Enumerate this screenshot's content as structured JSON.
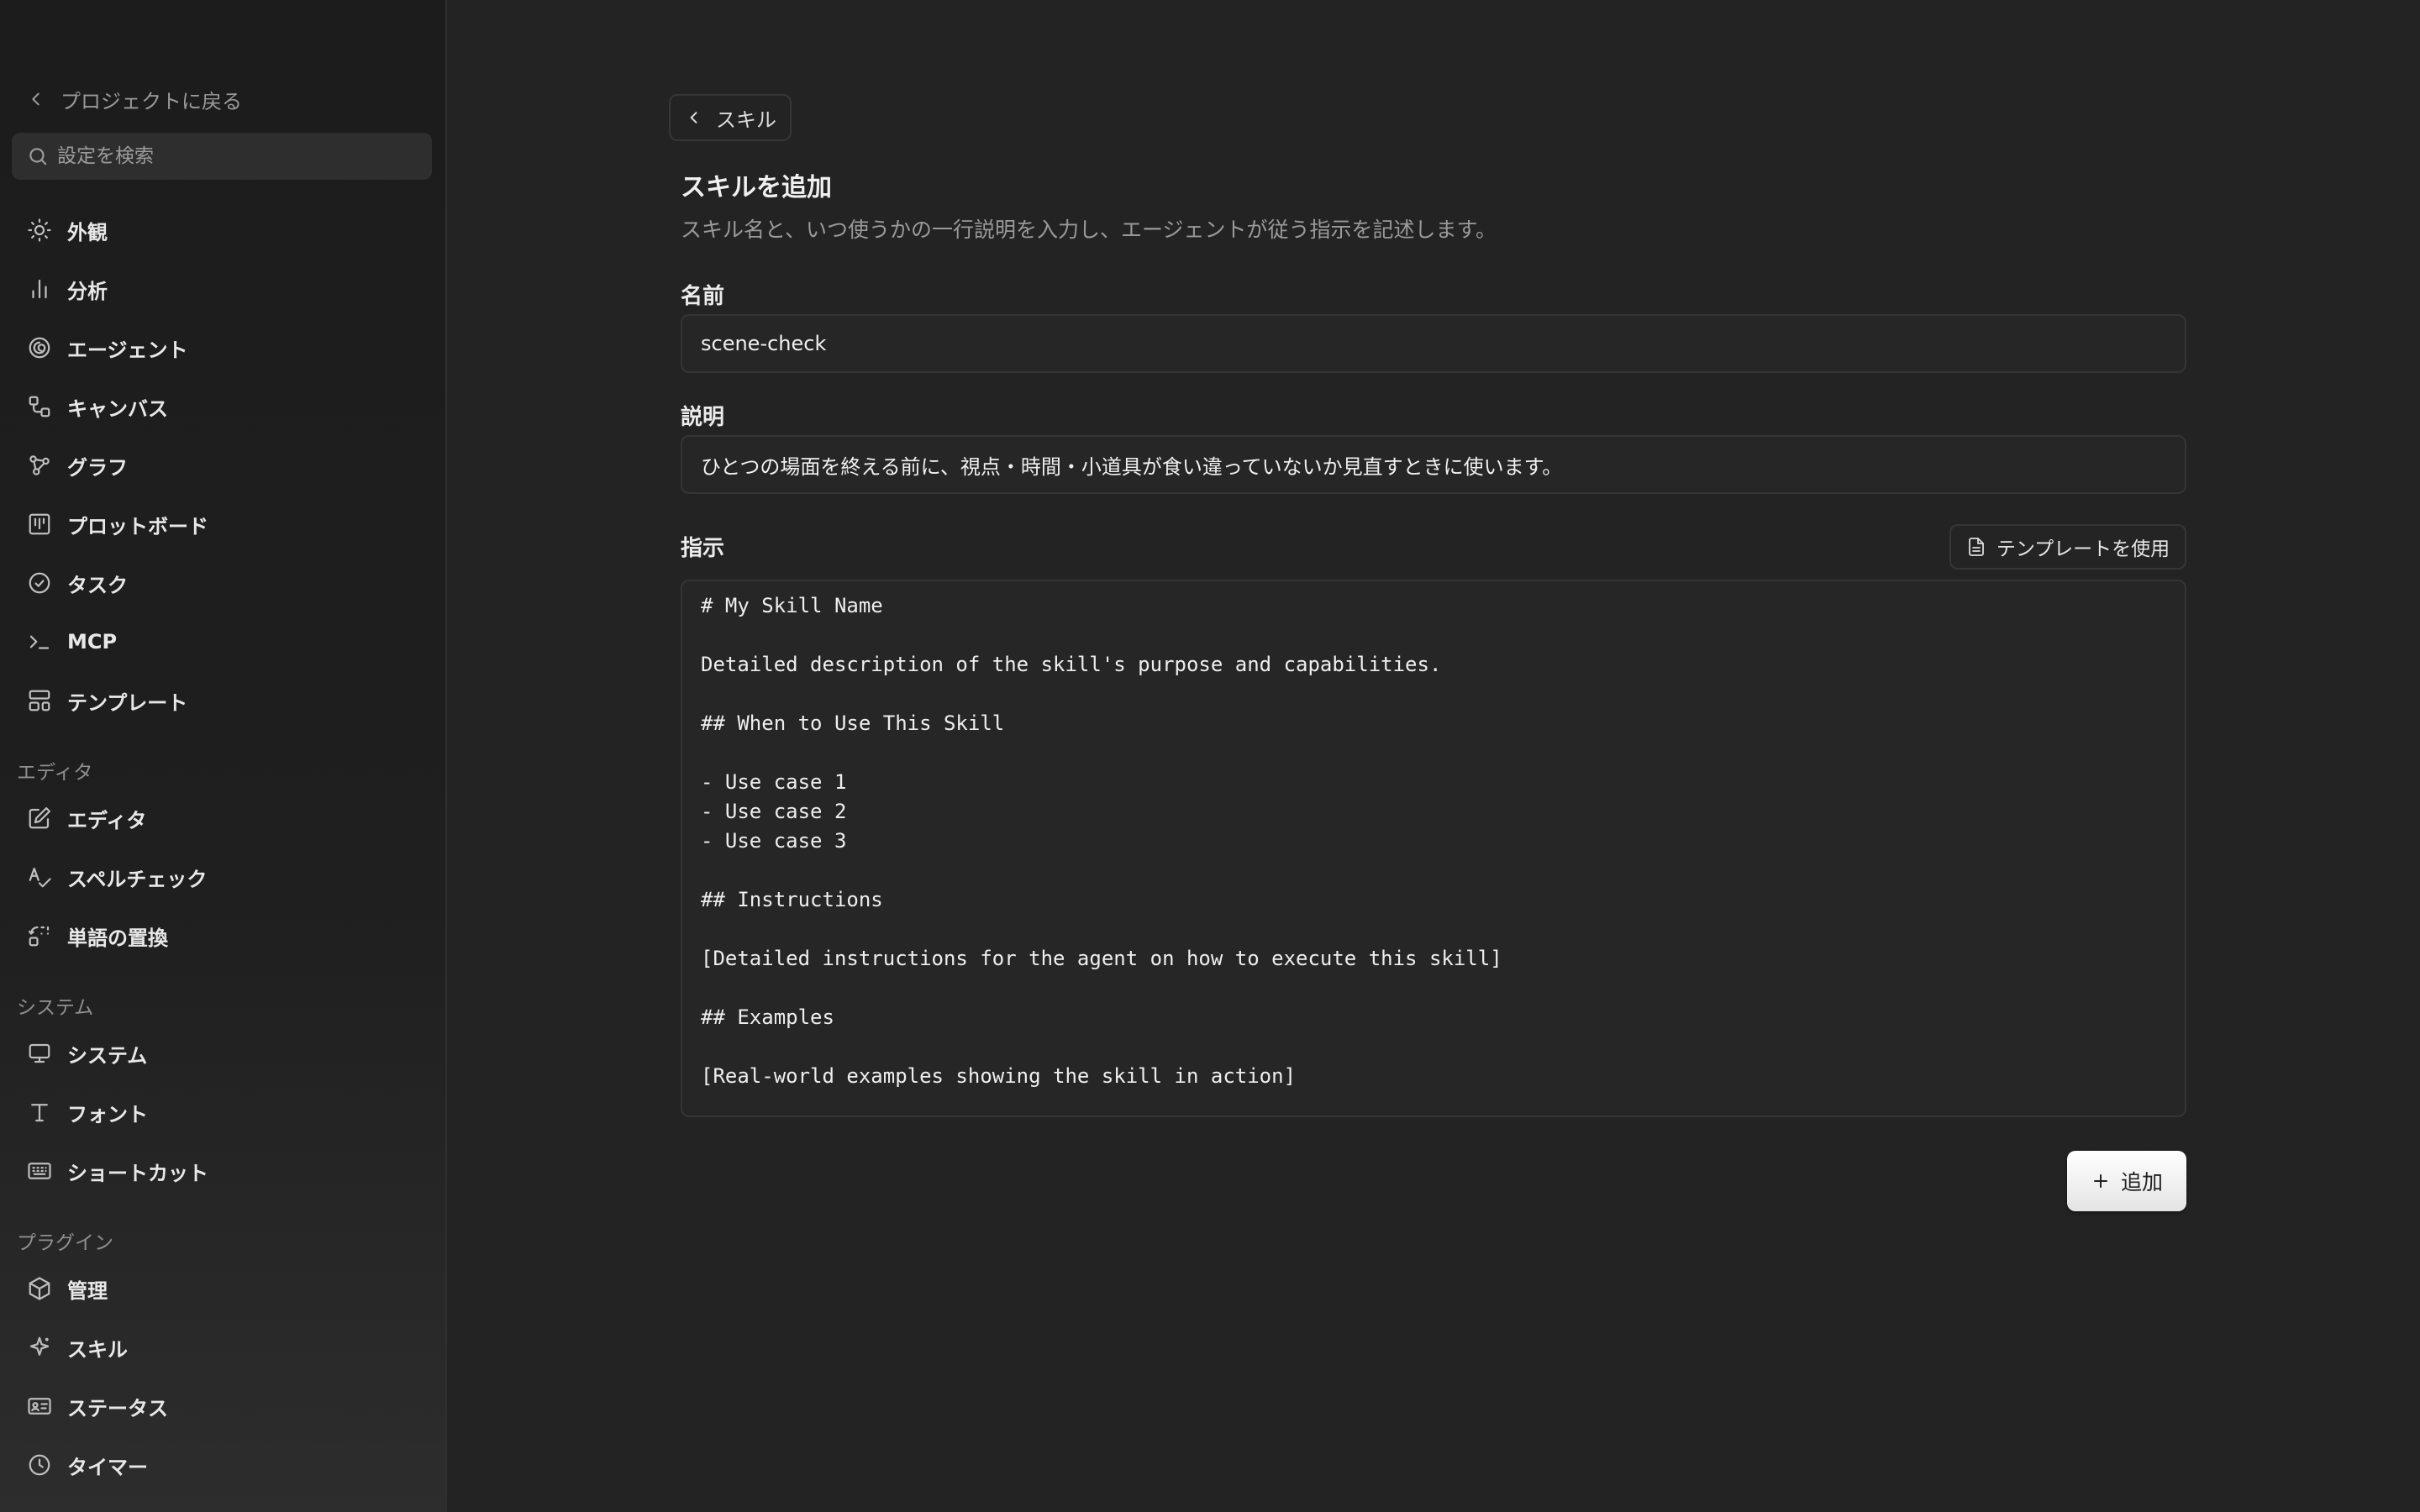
{
  "sidebar": {
    "back_label": "プロジェクトに戻る",
    "search_placeholder": "設定を検索",
    "items_general": [
      {
        "label": "外観",
        "icon": "sun-icon"
      },
      {
        "label": "分析",
        "icon": "bar-chart-icon"
      },
      {
        "label": "エージェント",
        "icon": "spiral-icon"
      },
      {
        "label": "キャンバス",
        "icon": "canvas-icon"
      },
      {
        "label": "グラフ",
        "icon": "graph-icon"
      },
      {
        "label": "プロットボード",
        "icon": "kanban-icon"
      },
      {
        "label": "タスク",
        "icon": "check-circle-icon"
      },
      {
        "label": "MCP",
        "icon": "terminal-icon"
      },
      {
        "label": "テンプレート",
        "icon": "layout-icon"
      }
    ],
    "section_editor": "エディタ",
    "items_editor": [
      {
        "label": "エディタ",
        "icon": "edit-icon"
      },
      {
        "label": "スペルチェック",
        "icon": "spellcheck-icon"
      },
      {
        "label": "単語の置換",
        "icon": "replace-icon"
      }
    ],
    "section_system": "システム",
    "items_system": [
      {
        "label": "システム",
        "icon": "monitor-icon"
      },
      {
        "label": "フォント",
        "icon": "type-icon"
      },
      {
        "label": "ショートカット",
        "icon": "keyboard-icon"
      }
    ],
    "section_plugins": "プラグイン",
    "items_plugins": [
      {
        "label": "管理",
        "icon": "package-icon"
      },
      {
        "label": "スキル",
        "icon": "sparkle-icon"
      },
      {
        "label": "ステータス",
        "icon": "id-card-icon"
      },
      {
        "label": "タイマー",
        "icon": "clock-icon"
      }
    ]
  },
  "main": {
    "breadcrumb_label": "スキル",
    "title": "スキルを追加",
    "description": "スキル名と、いつ使うかの一行説明を入力し、エージェントが従う指示を記述します。",
    "name_label": "名前",
    "name_value": "scene-check",
    "desc_label": "説明",
    "desc_value": "ひとつの場面を終える前に、視点・時間・小道具が食い違っていないか見直すときに使います。",
    "instructions_label": "指示",
    "template_button": "テンプレートを使用",
    "instructions_value": "# My Skill Name\n\nDetailed description of the skill's purpose and capabilities.\n\n## When to Use This Skill\n\n- Use case 1\n- Use case 2\n- Use case 3\n\n## Instructions\n\n[Detailed instructions for the agent on how to execute this skill]\n\n## Examples\n\n[Real-world examples showing the skill in action]",
    "add_button": "追加"
  }
}
